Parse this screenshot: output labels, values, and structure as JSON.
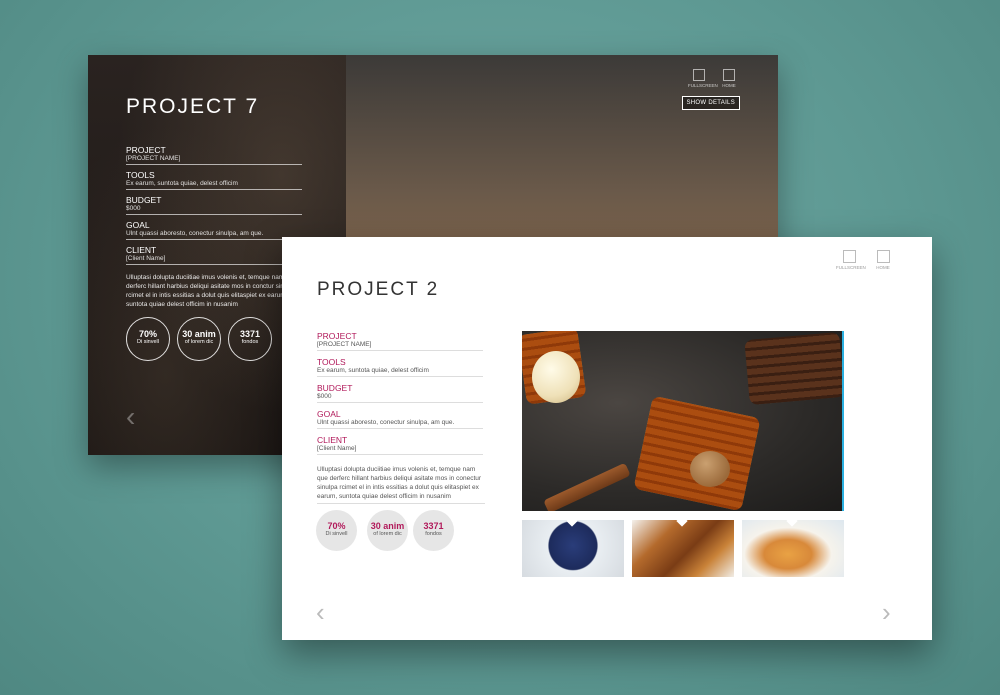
{
  "back_card": {
    "title": "PROJECT 7",
    "fields": [
      {
        "label": "PROJECT",
        "value": "[PROJECT NAME]"
      },
      {
        "label": "TOOLS",
        "value": "Ex earum, suntota quiae, delest officim"
      },
      {
        "label": "BUDGET",
        "value": "$000"
      },
      {
        "label": "GOAL",
        "value": "Ulnt quassi aboresto, conectur sinulpa, am que."
      },
      {
        "label": "CLIENT",
        "value": "[Client Name]"
      }
    ],
    "description": "Ulluptasi dolupta duciitiae imus volenis et, temque nam que derferc hillant harbius deliqui asitate mos in conctur sinulpa rcimet el in intis essitias a dolut quis elitaspiet ex earum, suntota quiae delest officim in nusanim",
    "stats": [
      {
        "number": "70%",
        "label": "Di sinvell"
      },
      {
        "number": "30 anim",
        "label": "of lorem dic"
      },
      {
        "number": "3371",
        "label": "fondos"
      }
    ],
    "show_details": "SHOW DETAILS",
    "icons": [
      {
        "name": "fullscreen-icon",
        "label": "FULLSCREEN"
      },
      {
        "name": "home-icon",
        "label": "HOME"
      }
    ]
  },
  "front_card": {
    "title": "PROJECT 2",
    "fields": [
      {
        "label": "PROJECT",
        "value": "[PROJECT NAME]"
      },
      {
        "label": "TOOLS",
        "value": "Ex earum, suntota quiae, delest officim"
      },
      {
        "label": "BUDGET",
        "value": "$000"
      },
      {
        "label": "GOAL",
        "value": "Ulnt quassi aboresto, conectur sinulpa, am que."
      },
      {
        "label": "CLIENT",
        "value": "[Client Name]"
      }
    ],
    "description": "Ulluptasi dolupta duciitiae imus volenis et, temque nam que derferc hillant harbius deliqui asitate mos in conectur sinulpa rcimet el in intis essitias a dolut quis elitaspiet ex earum, suntota quiae delest officim in nusanim",
    "stats": [
      {
        "number": "70%",
        "label": "Di sinvell"
      },
      {
        "number": "30 anim",
        "label": "of lorem dic"
      },
      {
        "number": "3371",
        "label": "fondos"
      }
    ],
    "icons": [
      {
        "name": "fullscreen-icon",
        "label": "FULLSCREEN"
      },
      {
        "name": "home-icon",
        "label": "HOME"
      }
    ],
    "prev_arrow": "‹",
    "next_arrow": "›"
  },
  "colors": {
    "accent": "#b1195a",
    "background": "#5e9993",
    "selected_thumb": "#2bb0e0"
  }
}
